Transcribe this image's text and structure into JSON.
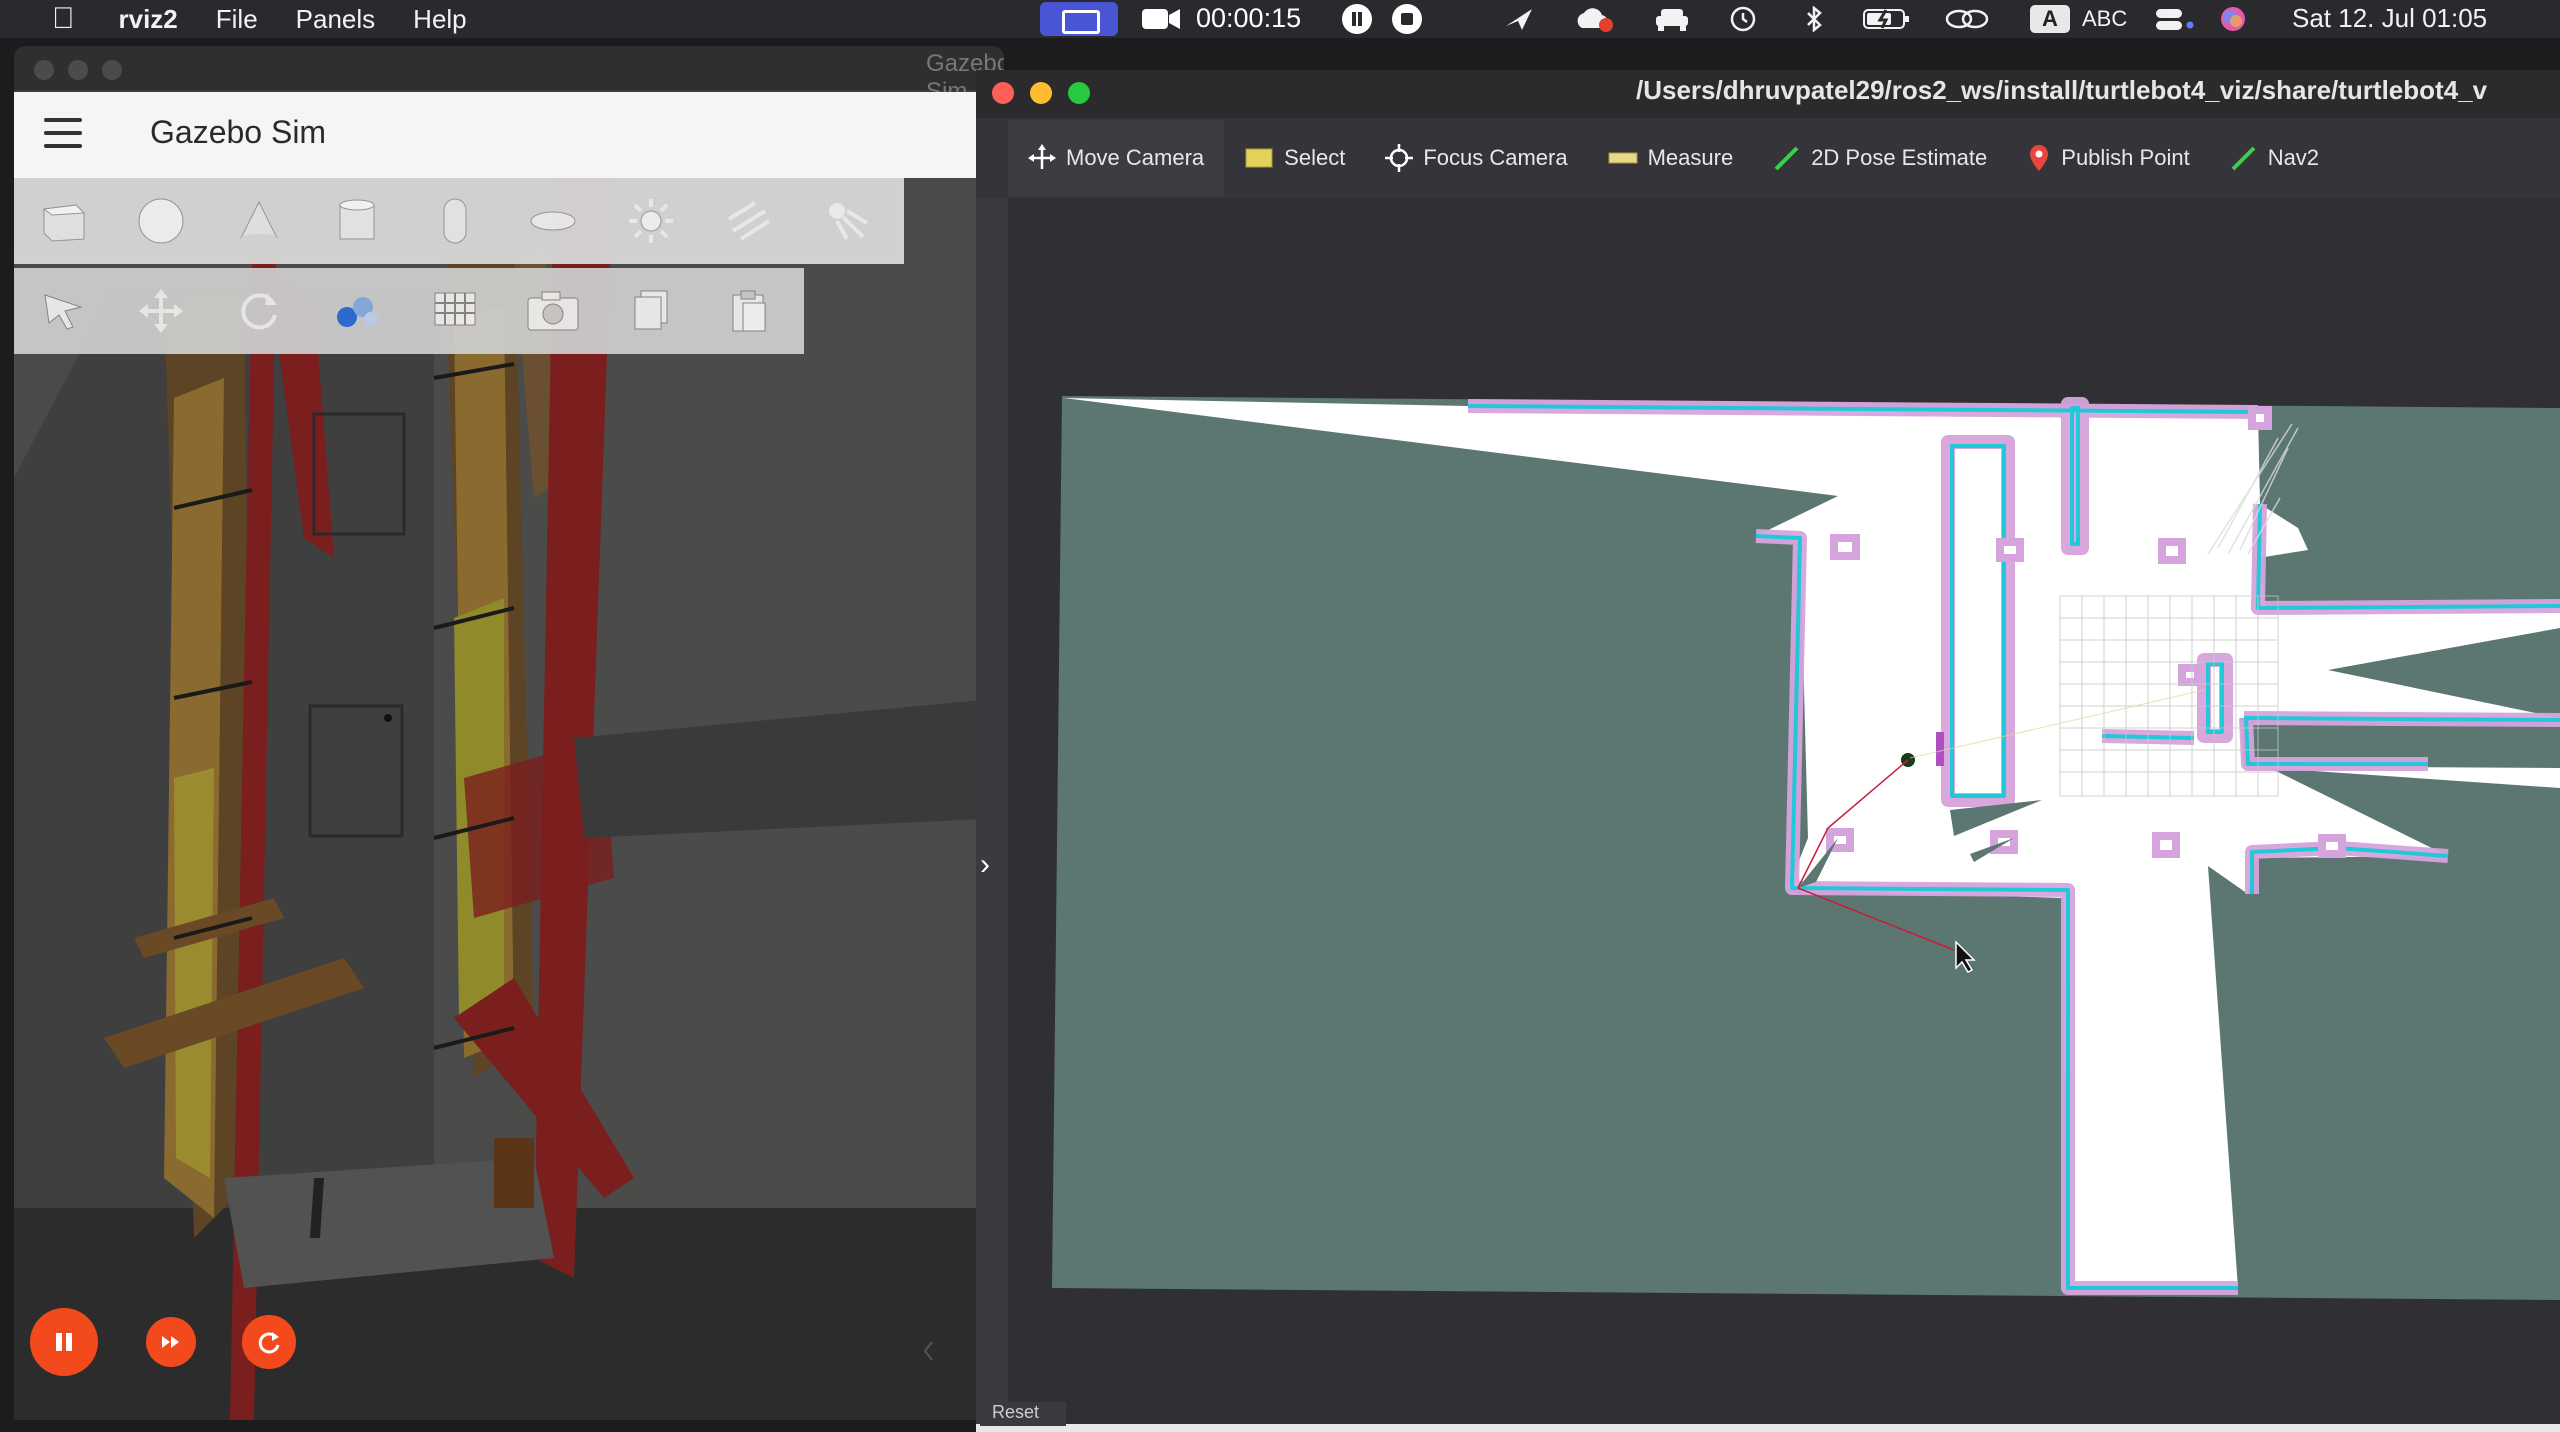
{
  "menubar": {
    "app_name": "rviz2",
    "menus": [
      "File",
      "Panels",
      "Help"
    ],
    "recording_time": "00:00:15",
    "input_badge": "A",
    "input_label": "ABC",
    "datetime": "Sat 12. Jul  01:05"
  },
  "gazebo": {
    "window_title": "Gazebo Sim",
    "app_title": "Gazebo Sim",
    "shape_tools": [
      "box-icon",
      "sphere-icon",
      "cone-icon",
      "cylinder-icon",
      "capsule-icon",
      "ellipsoid-icon",
      "sun-light-icon",
      "directional-light-icon",
      "spot-light-icon"
    ],
    "transform_tools": [
      "select-pointer-icon",
      "translate-icon",
      "rotate-icon",
      "grid-snap-icon",
      "grid-icon",
      "screenshot-camera-icon",
      "copy-icon",
      "paste-icon"
    ],
    "controls": [
      "pause-icon",
      "step-icon",
      "reset-icon"
    ]
  },
  "rviz": {
    "window_title": "/Users/dhruvpatel29/ros2_ws/install/turtlebot4_viz/share/turtlebot4_v",
    "tools": [
      {
        "label": "Move Camera",
        "icon": "move-camera-icon"
      },
      {
        "label": "Select",
        "icon": "select-icon"
      },
      {
        "label": "Focus Camera",
        "icon": "focus-camera-icon"
      },
      {
        "label": "Measure",
        "icon": "measure-icon"
      },
      {
        "label": "2D Pose Estimate",
        "icon": "pose-estimate-arrow-icon"
      },
      {
        "label": "Publish Point",
        "icon": "publish-point-pin-icon"
      },
      {
        "label": "Nav2 ",
        "icon": "nav2-goal-arrow-icon"
      }
    ],
    "reset_label": "Reset",
    "colors": {
      "map_free": "#ffffff",
      "map_unknown": "#5c7672",
      "wall_costmap": "#d6a4dc",
      "wall_core": "#21c8d8",
      "laser_scan": "#c81e3c",
      "background": "#2f2f34"
    }
  }
}
